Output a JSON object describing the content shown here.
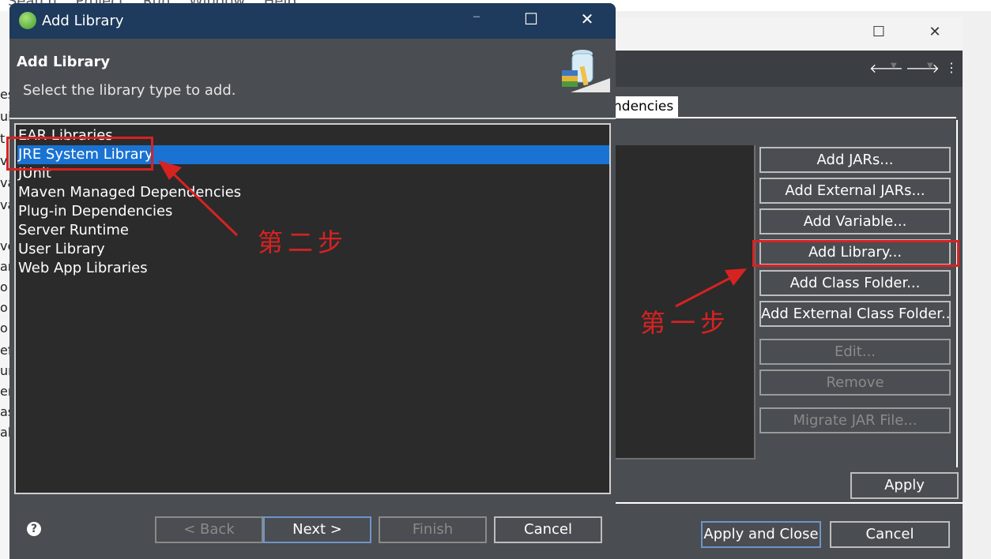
{
  "ide": {
    "menu_fragment": "Search Project Run Window Help",
    "left_fragments": [
      "es",
      "ui",
      "t",
      "v",
      "va",
      "va",
      "ve",
      "ar",
      "o",
      "o",
      "o",
      "ef",
      "ur",
      "er",
      "as",
      "al"
    ]
  },
  "props": {
    "tab_label": "ndencies",
    "buttons": [
      "Add JARs...",
      "Add External JARs...",
      "Add Variable...",
      "Add Library...",
      "Add Class Folder...",
      "Add External Class Folder...",
      "Edit...",
      "Remove",
      "Migrate JAR File..."
    ],
    "apply_label": "Apply",
    "apply_close_label": "Apply and Close",
    "cancel_label": "Cancel"
  },
  "dialog": {
    "title": "Add Library",
    "heading": "Add Library",
    "subtitle": "Select the library type to add.",
    "libraries": [
      "EAR Libraries",
      "JRE System Library",
      "JUnit",
      "Maven Managed Dependencies",
      "Plug-in Dependencies",
      "Server Runtime",
      "User Library",
      "Web App Libraries"
    ],
    "selected_index": 1,
    "back_label": "< Back",
    "next_label": "Next >",
    "finish_label": "Finish",
    "cancel_label": "Cancel",
    "help_glyph": "?"
  },
  "annotations": {
    "step_one": "第一步",
    "step_two": "第二步",
    "color": "#d72222"
  },
  "colors": {
    "title_bar": "#1e3a5c",
    "panel_bg": "#4a4d51",
    "list_bg": "#2b2b2b",
    "selection": "#1a73d2"
  }
}
